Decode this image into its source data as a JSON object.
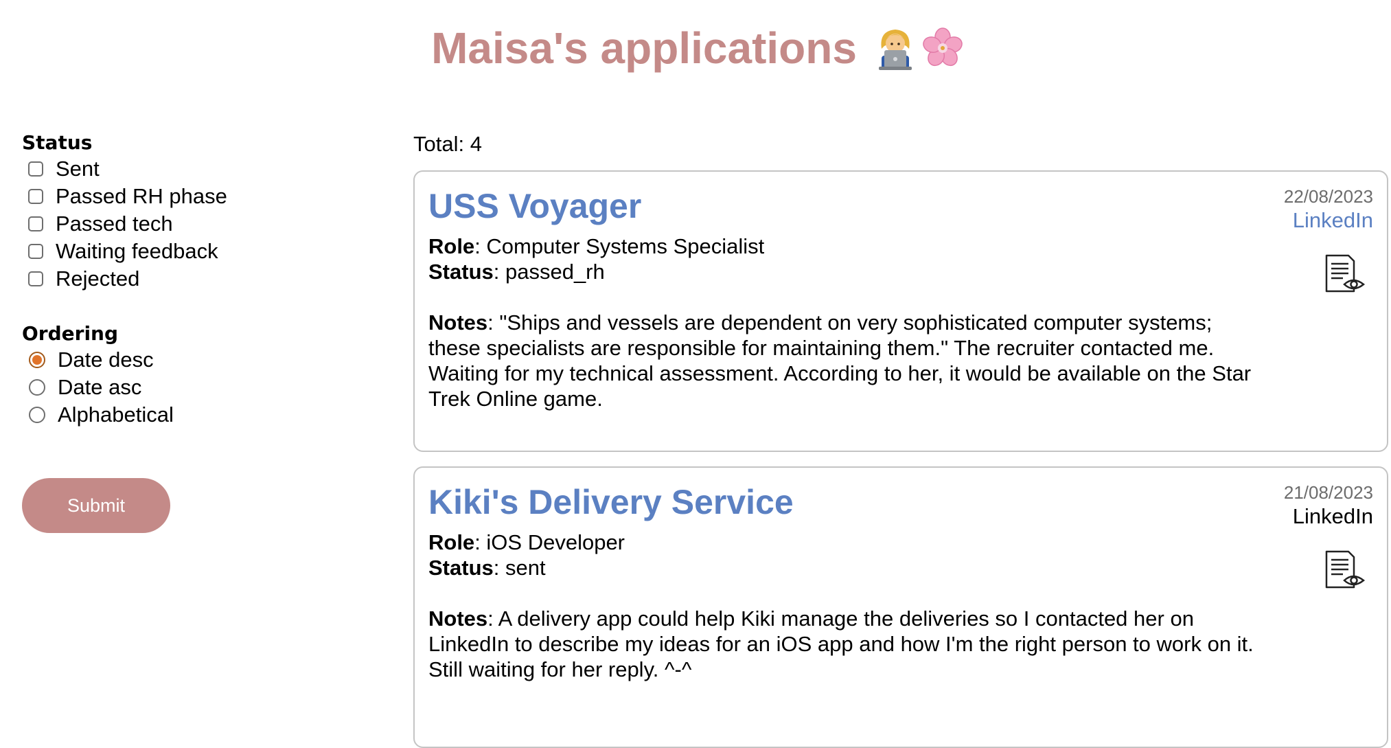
{
  "header": {
    "title": "Maisa's applications",
    "emoji_icons": [
      "woman-technologist-icon",
      "cherry-blossom-icon"
    ]
  },
  "filters": {
    "status_label": "Status",
    "status_options": [
      {
        "label": "Sent",
        "checked": false
      },
      {
        "label": "Passed RH phase",
        "checked": false
      },
      {
        "label": "Passed tech",
        "checked": false
      },
      {
        "label": "Waiting feedback",
        "checked": false
      },
      {
        "label": "Rejected",
        "checked": false
      }
    ],
    "ordering_label": "Ordering",
    "ordering_options": [
      {
        "label": "Date desc",
        "checked": true
      },
      {
        "label": "Date asc",
        "checked": false
      },
      {
        "label": "Alphabetical",
        "checked": false
      }
    ],
    "submit_label": "Submit"
  },
  "results": {
    "total_text": "Total: 4"
  },
  "applications": [
    {
      "company": "USS Voyager",
      "date": "22/08/2023",
      "source": "LinkedIn",
      "source_is_link": true,
      "role_label": "Role",
      "role": ": Computer Systems Specialist",
      "status_label": "Status",
      "status": ": passed_rh",
      "notes_label": "Notes",
      "notes": ": \"Ships and vessels are dependent on very sophisticated computer systems; these specialists are responsible for maintaining them.\" The recruiter contacted me. Waiting for my technical assessment. According to her, it would be available on the Star Trek Online game."
    },
    {
      "company": "Kiki's Delivery Service",
      "date": "21/08/2023",
      "source": "LinkedIn",
      "source_is_link": false,
      "role_label": "Role",
      "role": ": iOS Developer",
      "status_label": "Status",
      "status": ": sent",
      "notes_label": "Notes",
      "notes": ": A delivery app could help Kiki manage the deliveries so I contacted her on LinkedIn to describe my ideas for an iOS app and how I'm the right person to work on it. Still waiting for her reply. ^-^"
    }
  ],
  "colors": {
    "accent_pink": "#c48a88",
    "company_blue": "#5b80c2",
    "radio_orange": "#e1742a",
    "card_border": "#c4c4c4"
  }
}
